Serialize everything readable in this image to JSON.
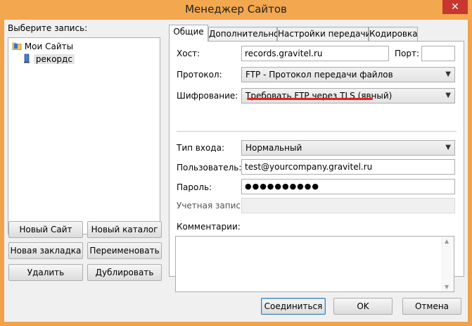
{
  "window": {
    "title": "Менеджер Сайтов",
    "close_glyph": "✕"
  },
  "left": {
    "select_label": "Выберите запись:",
    "tree": {
      "root": "Мои Сайты",
      "child": "рекордс"
    },
    "buttons": {
      "new_site": "Новый Сайт",
      "new_folder": "Новый каталог",
      "new_bookmark": "Новая закладка",
      "rename": "Переименовать",
      "delete": "Удалить",
      "duplicate": "Дублировать"
    }
  },
  "tabs": [
    {
      "label": "Общие",
      "active": true
    },
    {
      "label": "Дополнительно",
      "active": false
    },
    {
      "label": "Настройки передачи",
      "active": false
    },
    {
      "label": "Кодировка",
      "active": false
    }
  ],
  "general": {
    "host_label": "Хост:",
    "host_value": "records.gravitel.ru",
    "port_label": "Порт:",
    "port_value": "",
    "protocol_label": "Протокол:",
    "protocol_value": "FTP - Протокол передачи файлов",
    "encryption_label": "Шифрование:",
    "encryption_value": "Требовать FTP через TLS (явный)",
    "logon_label": "Тип входа:",
    "logon_value": "Нормальный",
    "user_label": "Пользователь:",
    "user_value": "test@yourcompany.gravitel.ru",
    "password_label": "Пароль:",
    "password_value": "●●●●●●●●●●",
    "account_label": "Учетная запись:",
    "account_value": "",
    "comments_label": "Комментарии:",
    "comments_value": ""
  },
  "footer": {
    "connect": "Соединиться",
    "ok": "OK",
    "cancel": "Отмена"
  },
  "colors": {
    "titlebar": "#f3a74f",
    "close": "#c7362f",
    "highlight_underline": "#e8201c"
  },
  "icons": {
    "tree_root": "folder-icon",
    "tree_child": "server-icon",
    "dropdown": "chevron-down-icon"
  }
}
